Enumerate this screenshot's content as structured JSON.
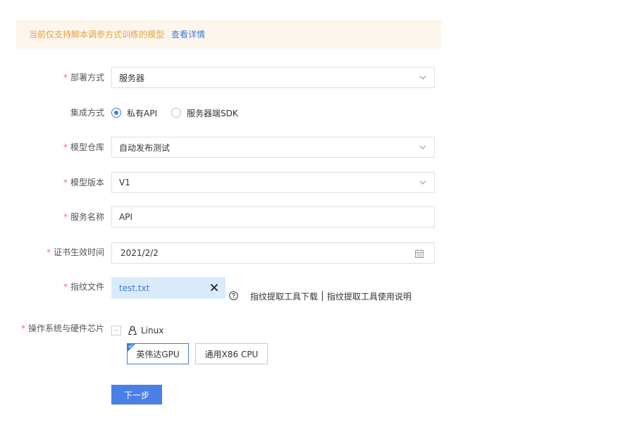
{
  "notice": {
    "text": "当前仅支持脚本调参方式训练的模型",
    "link": "查看详情"
  },
  "form": {
    "deploy": {
      "label": "部署方式",
      "value": "服务器"
    },
    "integration": {
      "label": "集成方式",
      "options": [
        {
          "label": "私有API",
          "selected": true
        },
        {
          "label": "服务器端SDK",
          "selected": false
        }
      ]
    },
    "repo": {
      "label": "模型仓库",
      "value": "自动发布测试"
    },
    "version": {
      "label": "模型版本",
      "value": "V1"
    },
    "service": {
      "label": "服务名称",
      "value": "API"
    },
    "cert": {
      "label": "证书生效时间",
      "value": "2021/2/2"
    },
    "fingerprint": {
      "label": "指纹文件",
      "file": "test.txt",
      "tool_download": "指纹提取工具下载",
      "tool_doc": "指纹提取工具使用说明"
    },
    "os": {
      "label": "操作系统与硬件芯片",
      "name": "Linux",
      "chips": [
        {
          "label": "英伟达GPU",
          "selected": true
        },
        {
          "label": "通用X86 CPU",
          "selected": false
        }
      ]
    },
    "required_mark": "*"
  },
  "next_button": "下一步",
  "colors": {
    "accent": "#3c7ce0",
    "warning": "#e6a23c",
    "required": "#f56c6c",
    "notice_bg": "#fdf6ec",
    "file_bg": "#d9ebfb"
  }
}
